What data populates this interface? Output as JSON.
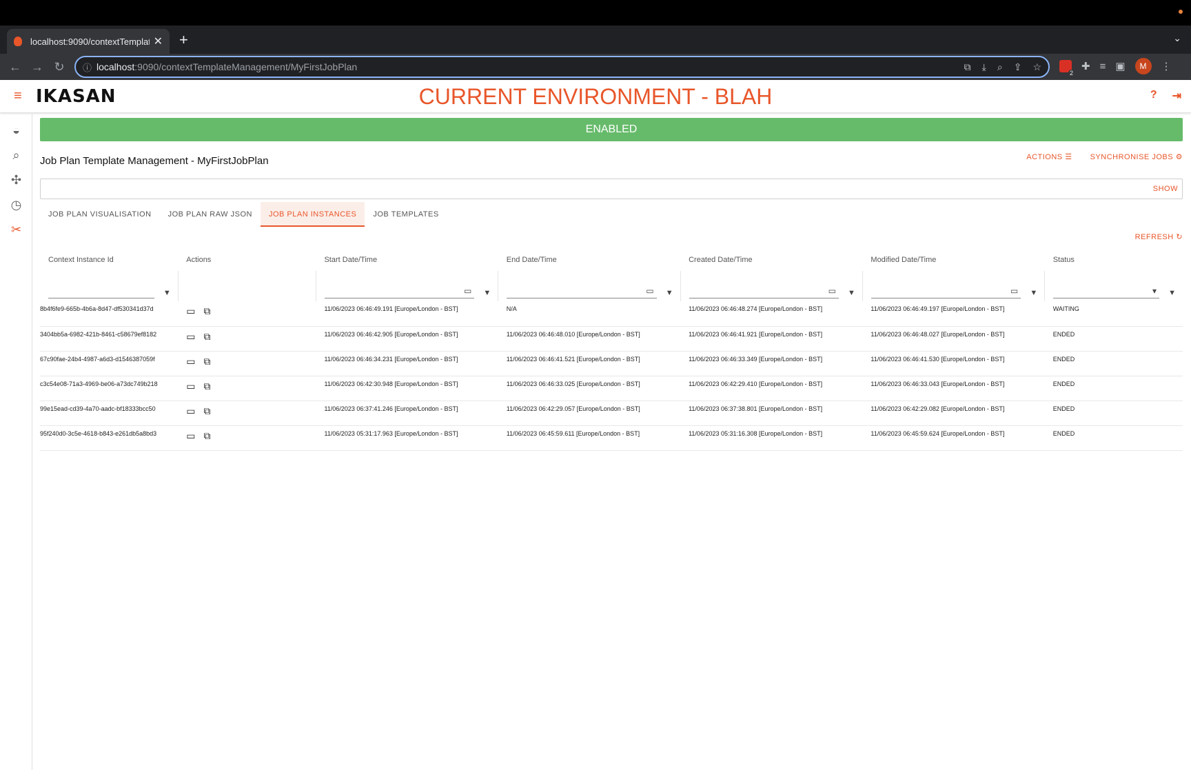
{
  "browser": {
    "tab_title": "localhost:9090/contextTemplat",
    "url_host": "localhost",
    "url_path": ":9090/contextTemplateManagement/MyFirstJobPlan",
    "ext_badge": "2",
    "avatar_letter": "M"
  },
  "header": {
    "logo": "IKASAN",
    "env_title": "CURRENT ENVIRONMENT - BLAH"
  },
  "status_bar": {
    "label": "ENABLED",
    "color": "#66bb6a"
  },
  "page": {
    "title": "Job Plan Template Management - MyFirstJobPlan",
    "actions_label": "ACTIONS",
    "sync_label": "SYNCHRONISE JOBS",
    "show_label": "SHOW",
    "refresh_label": "REFRESH"
  },
  "tabs": [
    {
      "label": "JOB PLAN VISUALISATION"
    },
    {
      "label": "JOB PLAN RAW JSON"
    },
    {
      "label": "JOB PLAN INSTANCES",
      "active": true
    },
    {
      "label": "JOB TEMPLATES"
    }
  ],
  "table": {
    "columns": [
      "Context Instance Id",
      "Actions",
      "Start Date/Time",
      "End Date/Time",
      "Created Date/Time",
      "Modified Date/Time",
      "Status"
    ],
    "rows": [
      {
        "id": "8b4f6fe9-665b-4b6a-8d47-df530341d37d",
        "start": "11/06/2023 06:46:49.191 [Europe/London - BST]",
        "end": "N/A",
        "created": "11/06/2023 06:46:48.274 [Europe/London - BST]",
        "modified": "11/06/2023 06:46:49.197 [Europe/London - BST]",
        "status": "WAITING"
      },
      {
        "id": "3404bb5a-6982-421b-8461-c58679ef8182",
        "start": "11/06/2023 06:46:42.905 [Europe/London - BST]",
        "end": "11/06/2023 06:46:48.010 [Europe/London - BST]",
        "created": "11/06/2023 06:46:41.921 [Europe/London - BST]",
        "modified": "11/06/2023 06:46:48.027 [Europe/London - BST]",
        "status": "ENDED"
      },
      {
        "id": "67c90fae-24b4-4987-a6d3-d1546387059f",
        "start": "11/06/2023 06:46:34.231 [Europe/London - BST]",
        "end": "11/06/2023 06:46:41.521 [Europe/London - BST]",
        "created": "11/06/2023 06:46:33.349 [Europe/London - BST]",
        "modified": "11/06/2023 06:46:41.530 [Europe/London - BST]",
        "status": "ENDED"
      },
      {
        "id": "c3c54e08-71a3-4969-be06-a73dc749b218",
        "start": "11/06/2023 06:42:30.948 [Europe/London - BST]",
        "end": "11/06/2023 06:46:33.025 [Europe/London - BST]",
        "created": "11/06/2023 06:42:29.410 [Europe/London - BST]",
        "modified": "11/06/2023 06:46:33.043 [Europe/London - BST]",
        "status": "ENDED"
      },
      {
        "id": "99e15ead-cd39-4a70-aadc-bf18333bcc50",
        "start": "11/06/2023 06:37:41.246 [Europe/London - BST]",
        "end": "11/06/2023 06:42:29.057 [Europe/London - BST]",
        "created": "11/06/2023 06:37:38.801 [Europe/London - BST]",
        "modified": "11/06/2023 06:42:29.082 [Europe/London - BST]",
        "status": "ENDED"
      },
      {
        "id": "95f240d0-3c5e-4618-b843-e261db5a8bd3",
        "start": "11/06/2023 05:31:17.963 [Europe/London - BST]",
        "end": "11/06/2023 06:45:59.611 [Europe/London - BST]",
        "created": "11/06/2023 05:31:16.308 [Europe/London - BST]",
        "modified": "11/06/2023 06:45:59.624 [Europe/London - BST]",
        "status": "ENDED"
      }
    ]
  },
  "colors": {
    "accent": "#e8562a",
    "enabled": "#66bb6a"
  }
}
